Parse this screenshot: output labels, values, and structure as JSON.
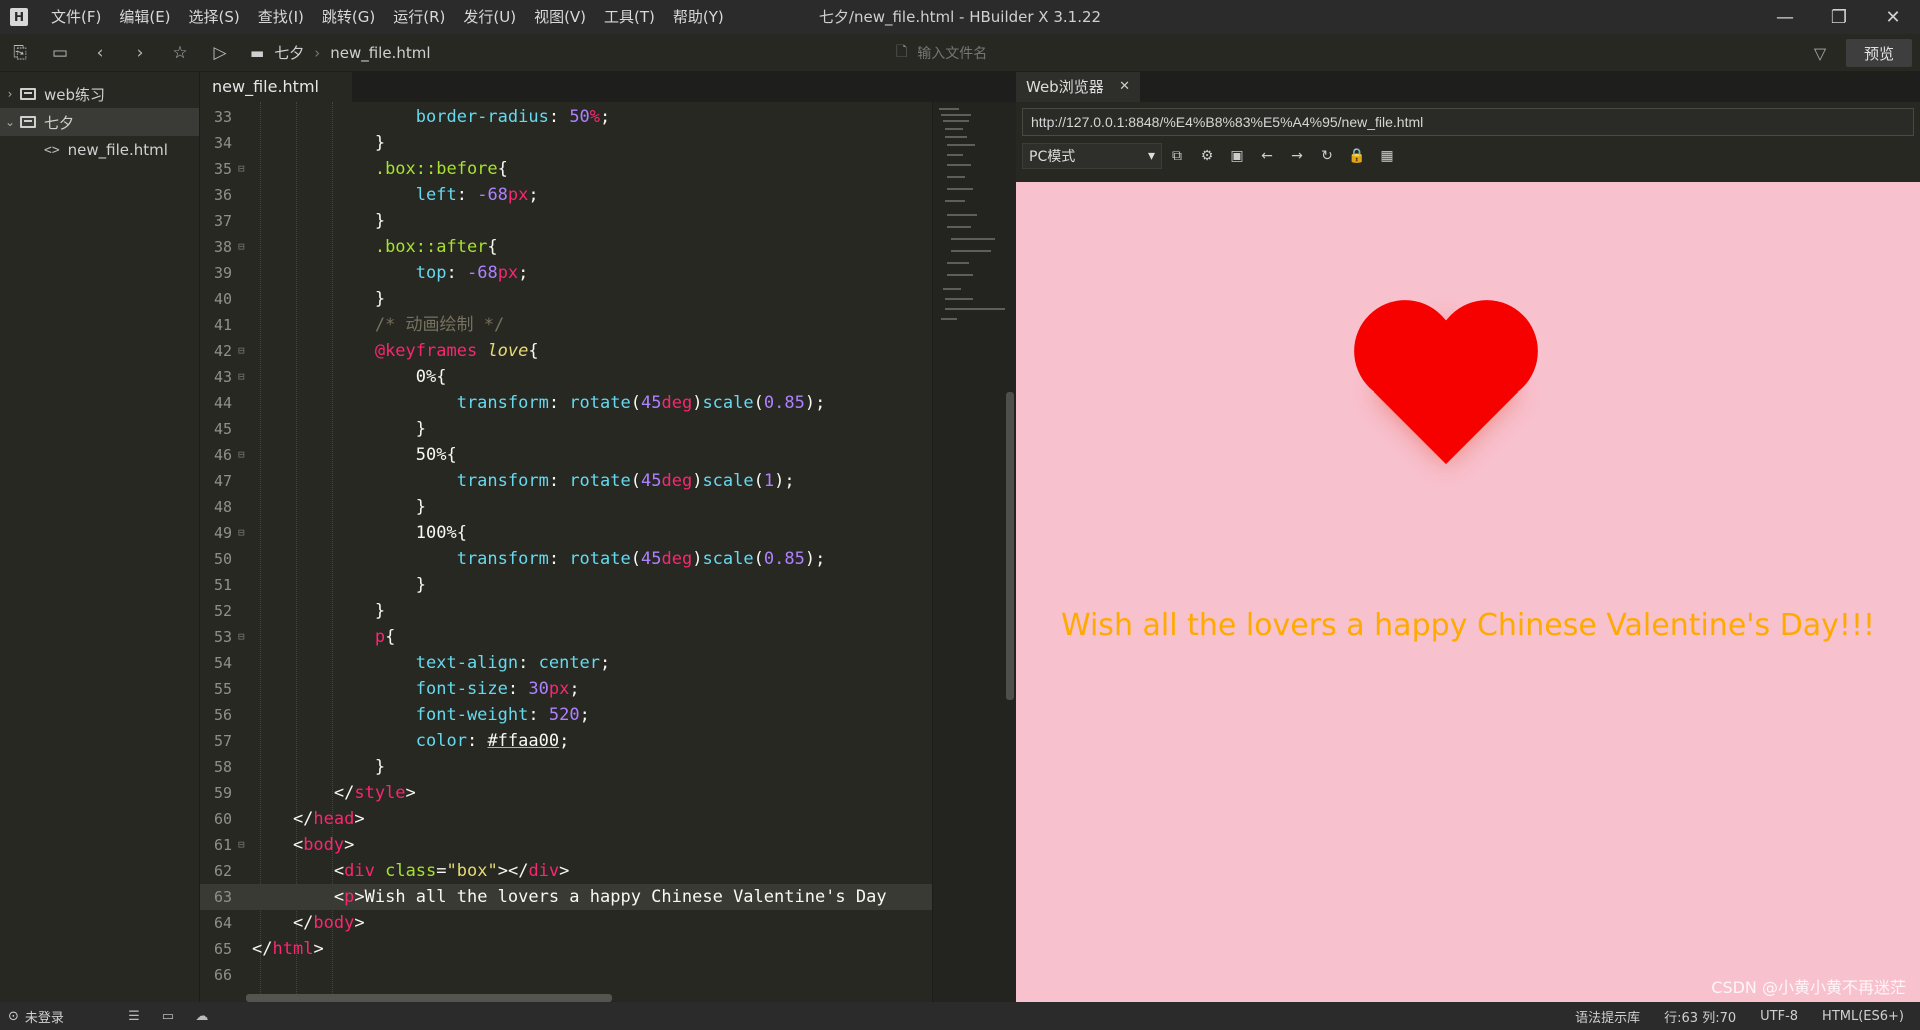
{
  "menu": {
    "logo": "H",
    "items": [
      "文件(F)",
      "编辑(E)",
      "选择(S)",
      "查找(I)",
      "跳转(G)",
      "运行(R)",
      "发行(U)",
      "视图(V)",
      "工具(T)",
      "帮助(Y)"
    ]
  },
  "window": {
    "title": "七夕/new_file.html - HBuilder X 3.1.22",
    "minimize": "—",
    "maximize": "❐",
    "close": "✕"
  },
  "toolbar": {
    "breadcrumb": [
      "七夕",
      "new_file.html"
    ],
    "search_placeholder": "输入文件名",
    "preview_label": "预览"
  },
  "sidebar": {
    "items": [
      {
        "label": "web练习",
        "expanded": false
      },
      {
        "label": "七夕",
        "expanded": true
      },
      {
        "label": "new_file.html"
      }
    ]
  },
  "editor": {
    "tab": "new_file.html"
  },
  "browser": {
    "tab_label": "Web浏览器",
    "url": "http://127.0.0.1:8848/%E4%B8%83%E5%A4%95/new_file.html",
    "mode": "PC模式",
    "page_text": "Wish all the lovers a happy Chinese Valentine's Day!!!",
    "text_color": "#ffaa00",
    "background_color": "#f8c1ce",
    "heart_color": "#f70000"
  },
  "status": {
    "login": "未登录",
    "syntax_lib": "语法提示库",
    "position": "行:63  列:70",
    "encoding": "UTF-8",
    "language": "HTML(ES6+)",
    "watermark": "CSDN @小黄小黄不再迷茫"
  }
}
